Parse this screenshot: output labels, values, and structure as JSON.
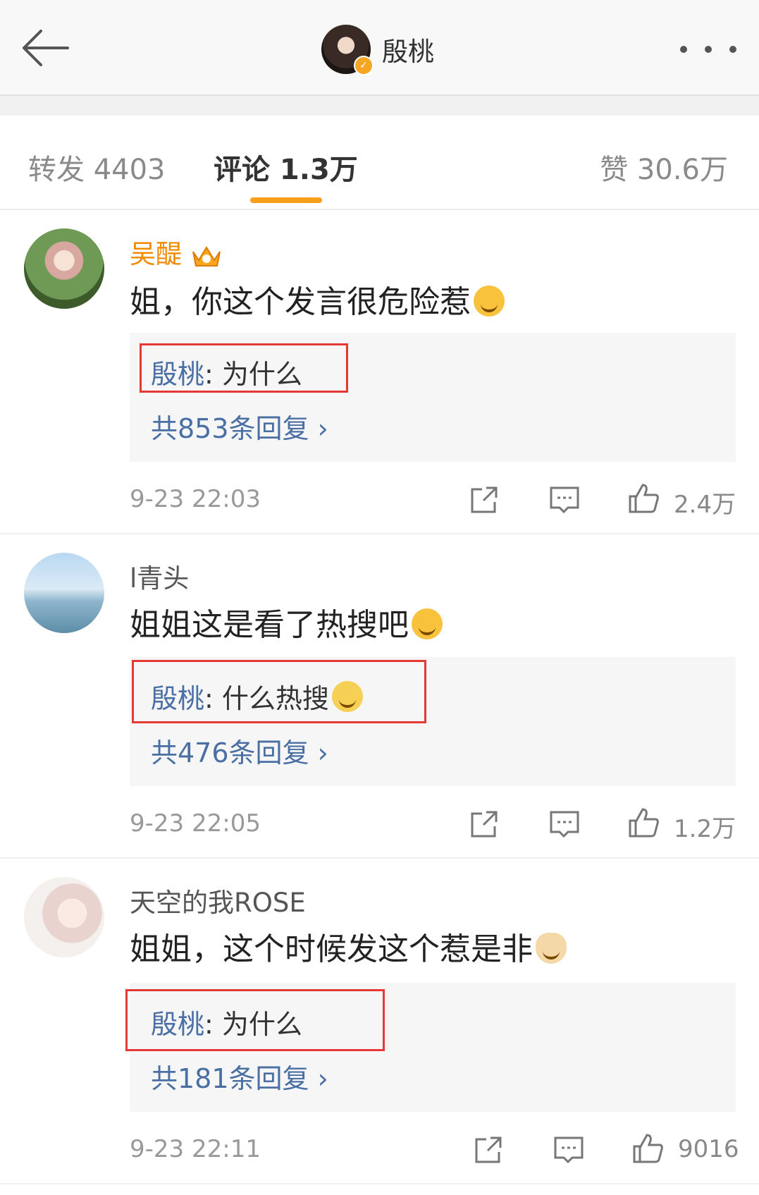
{
  "header": {
    "title": "殷桃",
    "back_icon": "back-arrow-icon",
    "more_icon": "more-dots-icon"
  },
  "tabs": {
    "repost": "转发 4403",
    "comment": "评论 1.3万",
    "like": "赞 30.6万",
    "active_color": "#f79e1b"
  },
  "comments": [
    {
      "user": "吴醍",
      "user_color": "#f08a00",
      "text": "姐，你这个发言很危险惹",
      "reply_name": "殷桃",
      "reply_text": ": 为什么",
      "reply_count": "共853条回复 ›",
      "time": "9-23 22:03",
      "likes": "2.4万"
    },
    {
      "user": "l青头",
      "text": "姐姐这是看了热搜吧",
      "reply_name": "殷桃",
      "reply_text": ": 什么热搜",
      "reply_count": "共476条回复 ›",
      "time": "9-23 22:05",
      "likes": "1.2万"
    },
    {
      "user": "天空的我ROSE",
      "text": "姐姐，这个时候发这个惹是非",
      "reply_name": "殷桃",
      "reply_text": ": 为什么",
      "reply_count": "共181条回复 ›",
      "time": "9-23 22:11",
      "likes": "9016"
    }
  ],
  "colors": {
    "link_blue": "#4a6fa5",
    "highlight_red": "#e53935"
  }
}
